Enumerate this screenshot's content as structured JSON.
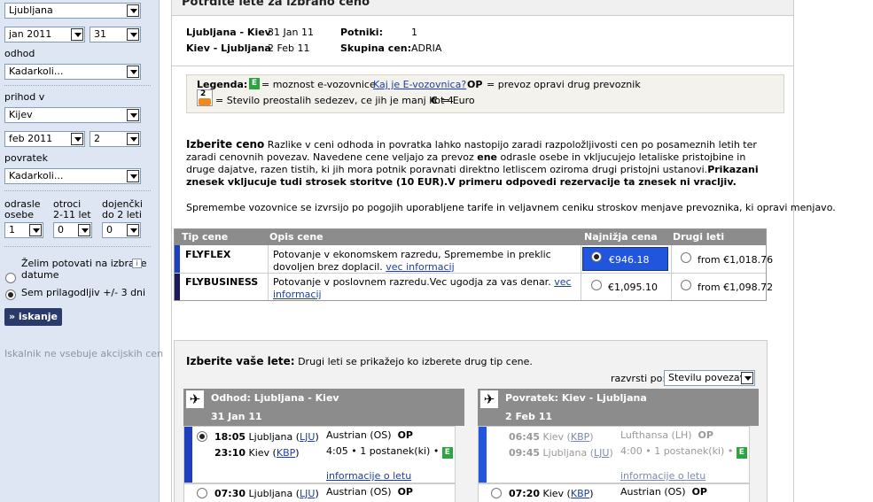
{
  "sidebar": {
    "from_value": "Ljubljana",
    "dep_month": "jan 2011",
    "dep_day": "31",
    "odhod_label": "odhod",
    "odhod_value": "Kadarkoli...",
    "prihod_label": "prihod v",
    "to_value": "Kijev",
    "ret_month": "feb 2011",
    "ret_day": "2",
    "povratek_label": "povratek",
    "povratek_value": "Kadarkoli...",
    "adults_label1": "odrasle",
    "adults_label2": "osebe",
    "children_label1": "otroci",
    "children_label2": "2-11 let",
    "infants_label1": "dojenčki",
    "infants_label2": "do 2 leti",
    "adults": "1",
    "children": "0",
    "infants": "0",
    "option_exact1": "Želim potovati na izbrane",
    "option_exact2": "datume",
    "info_icon": "i",
    "option_flex": "Sem prilagodljiv +/- 3 dni",
    "search_button": "» iskanje",
    "note": "Iskalnik ne vsebuje akcijskih cen"
  },
  "summary": {
    "title": "Potrdite lete za izbrano ceno",
    "route1": "Ljubljana - Kiev",
    "date1": "31 Jan 11",
    "route2": "Kiev - Ljubljana",
    "date2": "2 Feb 11",
    "pax_label": "Potniki:",
    "pax": "1",
    "group_label": "Skupina cen:",
    "group": "ADRIA"
  },
  "legend": {
    "title": "Legenda:",
    "e_badge": "E",
    "e_text": "= moznost e-vozovnice",
    "e_link": "Kaj je E-vozovnica?",
    "op_label": "OP",
    "op_text": "= prevoz opravi drug prevoznik",
    "seats_num": "2",
    "seats_text": "= Stevilo preostalih sedezev, ce jih je manj kot 4",
    "euro_label": "€",
    "euro_text": "= Euro"
  },
  "price_info": {
    "heading": "Izberite ceno",
    "p1_a": " Razlike v ceni odhoda in povratka lahko nastopijo zaradi razpoložljivosti cen po posameznih letih ter zaradi cenovnih povezav. Navedene cene veljajo za prevoz ",
    "p1_b": "ene",
    "p1_c": " odrasle osebe in vkljucujejo letaliske pristojbine in druge dajatve, razen tistih, ki jih mora potnik poravnati direktno letliscem oziroma drugi pristojni ustanovi.",
    "p1_d": "Prikazani znesek vkljucuje tudi strosek storitve (10 EUR).V primeru odpovedi rezervacije ta znesek ni vracljiv.",
    "p2": "Spremembe vozovnice se izvrsijo po pogojih uporabljene tarife in veljavnem ceniku stroskov menjave prevoznika, ki opravi menjavo."
  },
  "fare_table": {
    "headers": [
      "Tip cene",
      "Opis cene",
      "Najnižja cena",
      "Drugi leti"
    ],
    "rows": [
      {
        "name": "FLYFLEX",
        "desc": "Potovanje v ekonomskem razredu, Spremembe in preklic dovoljen brez doplacil. ",
        "link": "vec informacij",
        "price": "€946.18",
        "other": "from €1,018.76"
      },
      {
        "name": "FLYBUSINESS",
        "desc": "Potovanje v poslovnem razredu.Vec ugodja za vas denar. ",
        "link": "vec informacij",
        "price": "€1,095.10",
        "other": "from €1,098.72"
      }
    ]
  },
  "flights": {
    "title": "Izberite vaše lete:",
    "subtitle": " Drugi leti se prikažejo ko izberete drug tip cene.",
    "sort_label": "razvrsti po:",
    "sort_value": "Stevilu povezav",
    "outbound": {
      "header": "Odhod: Ljubljana - Kiev",
      "date": "31 Jan 11",
      "f1": {
        "dep_time": "18:05",
        "dep_city": "Ljubljana (",
        "dep_code": "LJU",
        "arr_time": "23:10",
        "arr_city": "Kiev (",
        "arr_code": "KBP",
        "close": ")",
        "airline": "Austrian (OS)",
        "op": "OP",
        "duration": "4:05",
        "dot": "•",
        "stops": "1 postanek(ki)",
        "e": "E",
        "link": "informacije o letu"
      },
      "f2": {
        "dep_time": "07:30",
        "dep_city": "Ljubljana (",
        "dep_code": "LJU",
        "close": ")",
        "airline": "Austrian (OS)",
        "op": "OP"
      }
    },
    "return": {
      "header": "Povratek: Kiev - Ljubljana",
      "date": "2 Feb 11",
      "f1": {
        "dep_time": "06:45",
        "dep_city": "Kiev (",
        "dep_code": "KBP",
        "arr_time": "09:45",
        "arr_city": "Ljubljana (",
        "arr_code": "LJU",
        "close": ")",
        "airline": "Lufthansa (LH)",
        "op": "OP",
        "duration": "4:00",
        "dot": "•",
        "stops": "1 postanek(ki)",
        "e": "E",
        "link": "informacije o letu"
      },
      "f2": {
        "dep_time": "07:20",
        "dep_city": "Kiev (",
        "dep_code": "KBP",
        "close": ")",
        "airline": "Austrian (OS)",
        "op": "OP"
      }
    }
  },
  "colors": {
    "sidebar_bg": "#dde6f2",
    "header_gray": "#8c8c8c",
    "accent_blue": "#1f3fbf",
    "navy": "#1a1a5a",
    "e_green": "#2aa540",
    "selected_blue": "#2255dd"
  }
}
